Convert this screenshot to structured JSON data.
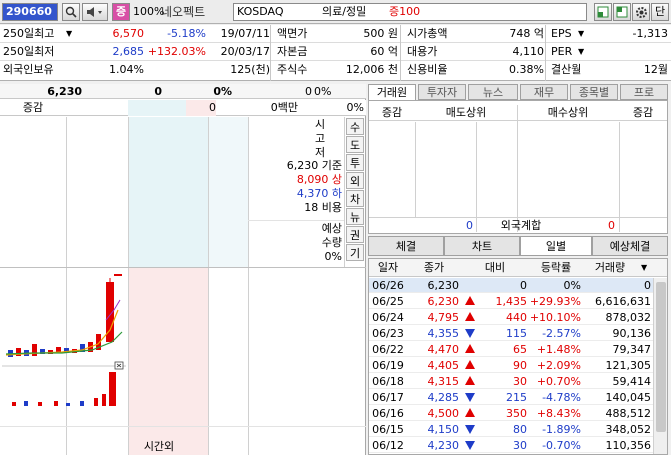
{
  "toolbar": {
    "code": "290660",
    "tag": "증",
    "ratio": "100%",
    "name": "네오펙트",
    "market": "KOSDAQ",
    "sector": "의료/정밀",
    "grade": "증100",
    "btn_right": "단"
  },
  "info": {
    "rows": [
      {
        "l1": "250일최고",
        "v1": "6,570",
        "p1": "-5.18%",
        "d1": "19/07/11",
        "l2": "액면가",
        "v2": "500 원",
        "l3": "시가총액",
        "v3": "748 억",
        "l4": "EPS",
        "v4": "-1,313"
      },
      {
        "l1": "250일최저",
        "v1": "2,685",
        "p1": "+132.03%",
        "d1": "20/03/17",
        "l2": "자본금",
        "v2": "60 억",
        "l3": "대용가",
        "v3": "4,110",
        "l4": "PER",
        "v4": ""
      },
      {
        "l1": "외국인보유",
        "v1": "1.04%",
        "p1": "",
        "d1": "125(천)",
        "l2": "주식수",
        "v2": "12,006 천",
        "l3": "신용비율",
        "v3": "0.38%",
        "l4": "결산월",
        "v4": "12월"
      }
    ]
  },
  "orderbook": {
    "price": "6,230",
    "change": "0",
    "change_pct": "0%",
    "vol": "0",
    "vol_pct": "0%",
    "h_label": "증감",
    "h_left": "0",
    "h_mid": "0",
    "h_amount": "0백만",
    "h_right": "0%",
    "labels": [
      "시",
      "고",
      "저"
    ],
    "base": "6,230 기준",
    "upper": "8,090 상",
    "lower": "4,370 하",
    "cost": "18 비용",
    "exp": "예상",
    "qty": "수량",
    "qty_pct": "0%",
    "side_btns": [
      "수",
      "도",
      "투",
      "외",
      "차",
      "뉴",
      "권",
      "기"
    ],
    "bottom_label": "시간외"
  },
  "right": {
    "tabs": [
      "거래원",
      "투자자",
      "뉴스",
      "재무",
      "종목별",
      "프로"
    ],
    "tr_headers": [
      "증감",
      "매도상위",
      "매수상위",
      "증감"
    ],
    "foreign_left": "0",
    "foreign_label": "외국계합",
    "foreign_right": "0",
    "btabs": [
      "체결",
      "차트",
      "일별",
      "예상체결"
    ],
    "cols": [
      "일자",
      "종가",
      "대비",
      "등락률",
      "거래량"
    ],
    "rows": [
      {
        "date": "06/26",
        "close": "6,230",
        "dir": "none",
        "diff": "0",
        "rate": "0%",
        "vol": "0",
        "c": ""
      },
      {
        "date": "06/25",
        "close": "6,230",
        "dir": "upper",
        "diff": "1,435",
        "rate": "+29.93%",
        "vol": "6,616,631",
        "c": "red"
      },
      {
        "date": "06/24",
        "close": "4,795",
        "dir": "up",
        "diff": "440",
        "rate": "+10.10%",
        "vol": "878,032",
        "c": "red"
      },
      {
        "date": "06/23",
        "close": "4,355",
        "dir": "down",
        "diff": "115",
        "rate": "-2.57%",
        "vol": "90,136",
        "c": "blue"
      },
      {
        "date": "06/22",
        "close": "4,470",
        "dir": "up",
        "diff": "65",
        "rate": "+1.48%",
        "vol": "79,347",
        "c": "red"
      },
      {
        "date": "06/19",
        "close": "4,405",
        "dir": "up",
        "diff": "90",
        "rate": "+2.09%",
        "vol": "121,305",
        "c": "red"
      },
      {
        "date": "06/18",
        "close": "4,315",
        "dir": "up",
        "diff": "30",
        "rate": "+0.70%",
        "vol": "59,414",
        "c": "red"
      },
      {
        "date": "06/17",
        "close": "4,285",
        "dir": "down",
        "diff": "215",
        "rate": "-4.78%",
        "vol": "140,045",
        "c": "blue"
      },
      {
        "date": "06/16",
        "close": "4,500",
        "dir": "up",
        "diff": "350",
        "rate": "+8.43%",
        "vol": "488,512",
        "c": "red"
      },
      {
        "date": "06/15",
        "close": "4,150",
        "dir": "down",
        "diff": "80",
        "rate": "-1.89%",
        "vol": "348,052",
        "c": "blue"
      },
      {
        "date": "06/12",
        "close": "4,230",
        "dir": "down",
        "diff": "30",
        "rate": "-0.70%",
        "vol": "110,356",
        "c": "blue"
      }
    ]
  },
  "colors": {
    "up": "#e00000",
    "down": "#1e3cc8",
    "selected_code_bg": "#3355cc",
    "ask_bg": "#e6f4f7",
    "bid_bg": "#fbe9e9"
  }
}
